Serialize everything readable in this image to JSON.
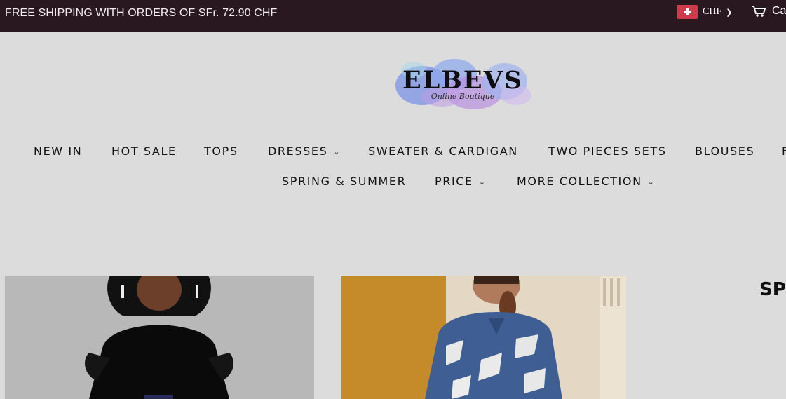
{
  "announcement": "FREE SHIPPING WITH ORDERS OF SFr. 72.90 CHF",
  "currency": {
    "code": "CHF",
    "flag_icon": "swiss-flag-icon"
  },
  "cart": {
    "label": "Ca",
    "icon": "cart-icon"
  },
  "logo": {
    "wordmark": "ELBEVS",
    "tagline": "Online Boutique"
  },
  "nav": {
    "items": [
      {
        "label": "NEW IN"
      },
      {
        "label": "HOT SALE"
      },
      {
        "label": "TOPS"
      },
      {
        "label": "DRESSES"
      },
      {
        "label": "SWEATER & CARDIGAN"
      },
      {
        "label": "TWO PIECES SETS"
      },
      {
        "label": "BLOUSES"
      },
      {
        "label": "F"
      },
      {
        "label": "SPRING & SUMMER"
      },
      {
        "label": "PRICE"
      },
      {
        "label": "MORE COLLECTION"
      }
    ]
  },
  "promo": {
    "side_title": "SPI"
  },
  "colors": {
    "topbar": "#2a1820",
    "page_bg": "#dcdcdc"
  }
}
